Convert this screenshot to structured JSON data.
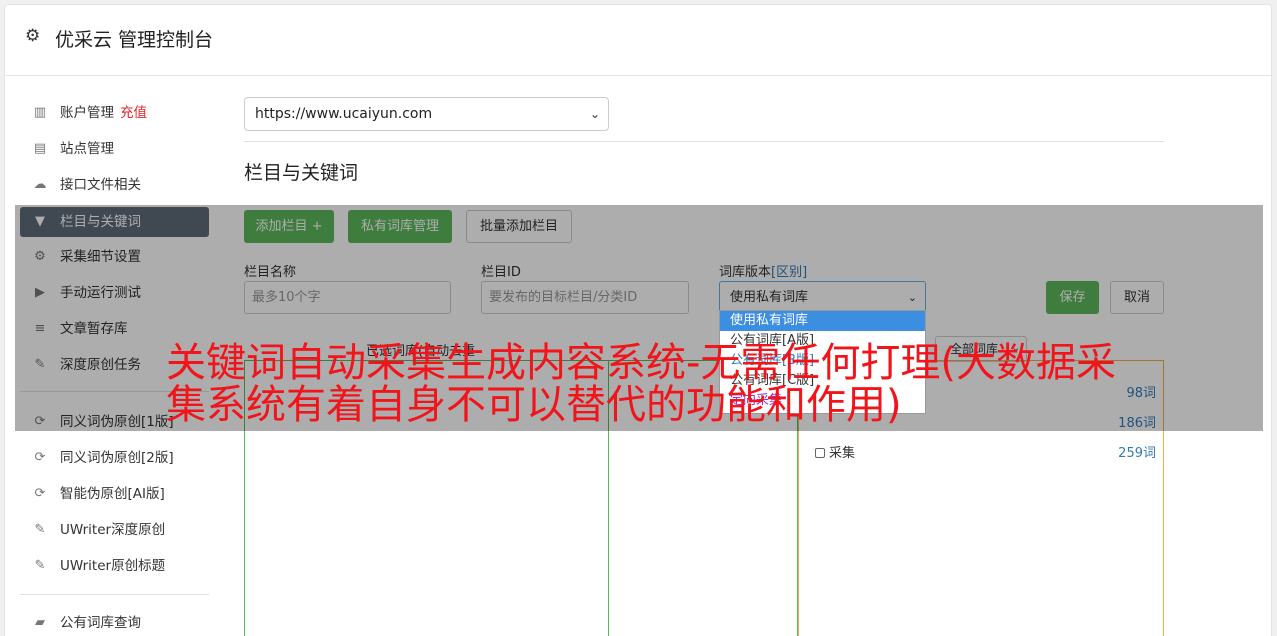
{
  "header": {
    "title": "优采云 管理控制台",
    "icon": "gear-icon"
  },
  "sidebar": {
    "items": [
      {
        "label": "账户管理",
        "badge": "充值",
        "icon": "bar-chart-icon"
      },
      {
        "label": "站点管理",
        "icon": "server-icon"
      },
      {
        "label": "接口文件相关",
        "icon": "cloud-upload-icon"
      },
      {
        "label": "栏目与关键词",
        "icon": "filter-icon",
        "active": true
      },
      {
        "label": "采集细节设置",
        "icon": "cogs-icon"
      },
      {
        "label": "手动运行测试",
        "icon": "play-icon"
      },
      {
        "label": "文章暂存库",
        "icon": "database-icon"
      },
      {
        "label": "深度原创任务",
        "icon": "edit-icon"
      },
      {
        "label": "同义词伪原创[1版]",
        "icon": "refresh-icon"
      },
      {
        "label": "同义词伪原创[2版]",
        "icon": "refresh-icon"
      },
      {
        "label": "智能伪原创[AI版]",
        "icon": "refresh-icon"
      },
      {
        "label": "UWriter深度原创",
        "icon": "edit-icon"
      },
      {
        "label": "UWriter原创标题",
        "icon": "edit-icon"
      },
      {
        "label": "公有词库查询",
        "icon": "book-icon"
      }
    ]
  },
  "main": {
    "site_select": {
      "value": "https://www.ucaiyun.com"
    },
    "section_title": "栏目与关键词",
    "buttons": {
      "add_column": "添加栏目 +",
      "private_lib": "私有词库管理",
      "batch_add": "批量添加栏目",
      "save": "保存",
      "cancel": "取消"
    },
    "form": {
      "name_label": "栏目名称",
      "name_placeholder": "最多10个字",
      "id_label": "栏目ID",
      "id_placeholder": "要发布的目标栏目/分类ID",
      "lib_label": "词库版本",
      "lib_label_link": "[区别]",
      "lib_value": "使用私有词库"
    },
    "dropdown_options": [
      "使用私有词库",
      "公有词库[A版]",
      "公有词库[B版]",
      "公有词库[C版]",
      "定向采集"
    ],
    "selected_label": "已选词库(自动去重",
    "filter_select": "全部词库",
    "counts": [
      "98词",
      "186词",
      "259词"
    ],
    "checkbox_label": "采集"
  },
  "overlay_text": "关键词自动采集生成内容系统-无需任何打理(大数据采集系统有着自身不可以替代的功能和作用)"
}
